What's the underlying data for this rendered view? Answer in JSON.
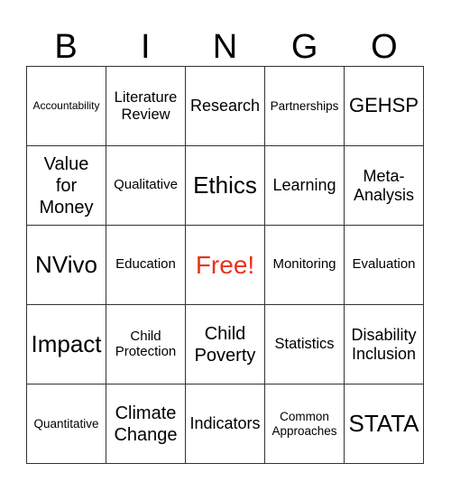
{
  "header": {
    "letters": [
      "B",
      "I",
      "N",
      "G",
      "O"
    ]
  },
  "colors": {
    "grid_line": "#333333",
    "text": "#000000",
    "free_space": "#e8331c",
    "background": "#ffffff"
  },
  "board": {
    "rows": [
      [
        "Accountability",
        "Literature Review",
        "Research",
        "Partnerships",
        "GEHSP"
      ],
      [
        "Value for Money",
        "Qualitative",
        "Ethics",
        "Learning",
        "Meta-Analysis"
      ],
      [
        "NVivo",
        "Education",
        "Free!",
        "Monitoring",
        "Evaluation"
      ],
      [
        "Impact",
        "Child Protection",
        "Child Poverty",
        "Statistics",
        "Disability Inclusion"
      ],
      [
        "Quantitative",
        "Climate Change",
        "Indicators",
        "Common Approaches",
        "STATA"
      ]
    ],
    "display": {
      "r0c0": "Accountability",
      "r0c1": "Literature\nReview",
      "r0c2": "Research",
      "r0c3": "Partnerships",
      "r0c4": "GEHSP",
      "r1c0": "Value\nfor\nMoney",
      "r1c1": "Qualitative",
      "r1c2": "Ethics",
      "r1c3": "Learning",
      "r1c4": "Meta-\nAnalysis",
      "r2c0": "NVivo",
      "r2c1": "Education",
      "r2c2": "Free!",
      "r2c3": "Monitoring",
      "r2c4": "Evaluation",
      "r3c0": "Impact",
      "r3c1": "Child\nProtection",
      "r3c2": "Child\nPoverty",
      "r3c3": "Statistics",
      "r3c4": "Disability\nInclusion",
      "r4c0": "Quantitative",
      "r4c1": "Climate\nChange",
      "r4c2": "Indicators",
      "r4c3": "Common\nApproaches",
      "r4c4": "STATA"
    },
    "free_space": "Free!"
  }
}
